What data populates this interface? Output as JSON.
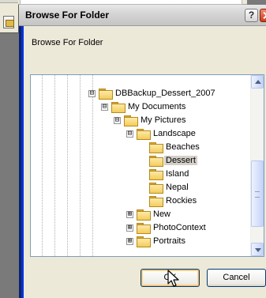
{
  "dialog": {
    "title": "Browse For Folder",
    "caption": "Browse For Folder",
    "help_label": "?",
    "ok_label": "OK",
    "cancel_label": "Cancel"
  },
  "tree": {
    "nodes": [
      {
        "label": "DBBackup_Dessert_2007",
        "expander": "⊟",
        "selected": false
      },
      {
        "label": "My Documents",
        "expander": "⊟",
        "selected": false
      },
      {
        "label": "My Pictures",
        "expander": "⊟",
        "selected": false
      },
      {
        "label": "Landscape",
        "expander": "⊟",
        "selected": false
      },
      {
        "label": "Beaches",
        "expander": "",
        "selected": false
      },
      {
        "label": "Dessert",
        "expander": "",
        "selected": true
      },
      {
        "label": "Island",
        "expander": "",
        "selected": false
      },
      {
        "label": "Nepal",
        "expander": "",
        "selected": false
      },
      {
        "label": "Rockies",
        "expander": "",
        "selected": false
      },
      {
        "label": "New",
        "expander": "⊞",
        "selected": false
      },
      {
        "label": "PhotoContext",
        "expander": "⊞",
        "selected": false
      },
      {
        "label": "Portraits",
        "expander": "⊞",
        "selected": false
      }
    ]
  },
  "colors": {
    "title_bar": "#d6d6d6",
    "close_button": "#c8401c",
    "border_accent": "#0a246a",
    "selection": "#d4d0c8"
  },
  "icons": [
    "folder-icon",
    "help-icon",
    "close-icon",
    "expand-icon",
    "collapse-icon",
    "scroll-up-icon",
    "scroll-down-icon",
    "cursor-icon"
  ]
}
